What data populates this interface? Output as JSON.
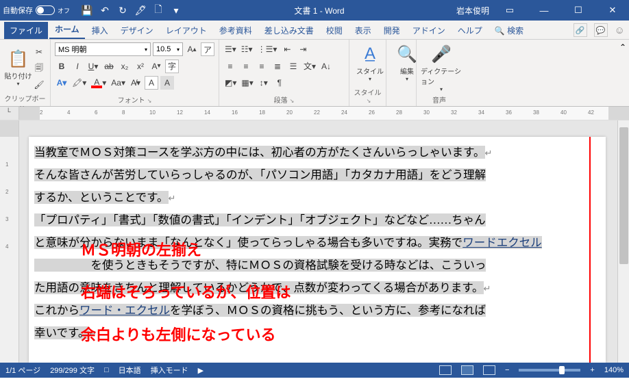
{
  "titlebar": {
    "autosave_label": "自動保存",
    "autosave_state": "オフ",
    "doc_title": "文書 1  -  Word",
    "username": "岩本俊明"
  },
  "tabs": {
    "file": "ファイル",
    "home": "ホーム",
    "insert": "挿入",
    "design": "デザイン",
    "layout": "レイアウト",
    "references": "参考資料",
    "mailings": "差し込み文書",
    "review": "校閲",
    "view": "表示",
    "developer": "開発",
    "addins": "アドイン",
    "help": "ヘルプ",
    "search": "検索"
  },
  "ribbon": {
    "clipboard": {
      "label": "クリップボード",
      "paste": "貼り付け"
    },
    "font": {
      "label": "フォント",
      "name": "MS 明朝",
      "size": "10.5"
    },
    "paragraph": {
      "label": "段落"
    },
    "styles": {
      "label": "スタイル",
      "btn": "スタイル"
    },
    "editing": {
      "label": "編集",
      "btn": "編集"
    },
    "voice": {
      "label": "音声",
      "btn": "ディクテーション"
    }
  },
  "ruler": {
    "marks": [
      2,
      4,
      6,
      8,
      10,
      12,
      14,
      16,
      18,
      20,
      22,
      24,
      26,
      28,
      30,
      32,
      34,
      36,
      38,
      40,
      42
    ]
  },
  "document": {
    "lines": [
      "当教室でＭＯＳ対策コースを学ぶ方の中には、初心者の方がたくさんいらっしゃいます。",
      "そんな皆さんが苦労していらっしゃるのが、「パソコン用語」「カタカナ用語」をどう理解",
      "するか、ということです。",
      "「プロパティ」「書式」「数値の書式」「インデント」「オブジェクト」などなど……ちゃん",
      "と意味が分からないまま「なんとなく」使ってらっしゃる場合も多いですね。実務で",
      "を使うときもそうですが、特にＭＯＳの資格試験を受ける時などは、こういっ",
      "た用語の意味をきちんと理解しているかどうかで、点数が変わってくる場合があります。",
      "これから",
      "を学ぼう、ＭＯＳの資格に挑もう、という方に、参考になれば",
      "幸いです。"
    ],
    "link1": "ワードエクセル",
    "link2": "ワード・エクセル"
  },
  "annotations": {
    "a1": "ＭＳ明朝の左揃え",
    "a2": "右端はそろっているが、位置は",
    "a3": "余白よりも左側になっている"
  },
  "statusbar": {
    "page": "1/1 ページ",
    "words": "299/299 文字",
    "lang": "日本語",
    "mode": "挿入モード",
    "zoom": "140%"
  }
}
